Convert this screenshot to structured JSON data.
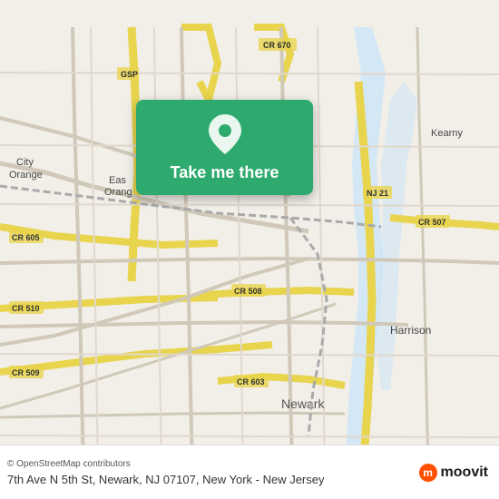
{
  "map": {
    "background_color": "#f2efe9",
    "alt": "Street map of Newark NJ area"
  },
  "location_card": {
    "button_label": "Take me there",
    "pin_color": "#ffffff",
    "card_color": "#2eaa6e"
  },
  "bottom_bar": {
    "osm_credit": "© OpenStreetMap contributors",
    "address": "7th Ave N 5th St, Newark, NJ 07107, New York - New Jersey",
    "moovit_label": "moovit"
  }
}
